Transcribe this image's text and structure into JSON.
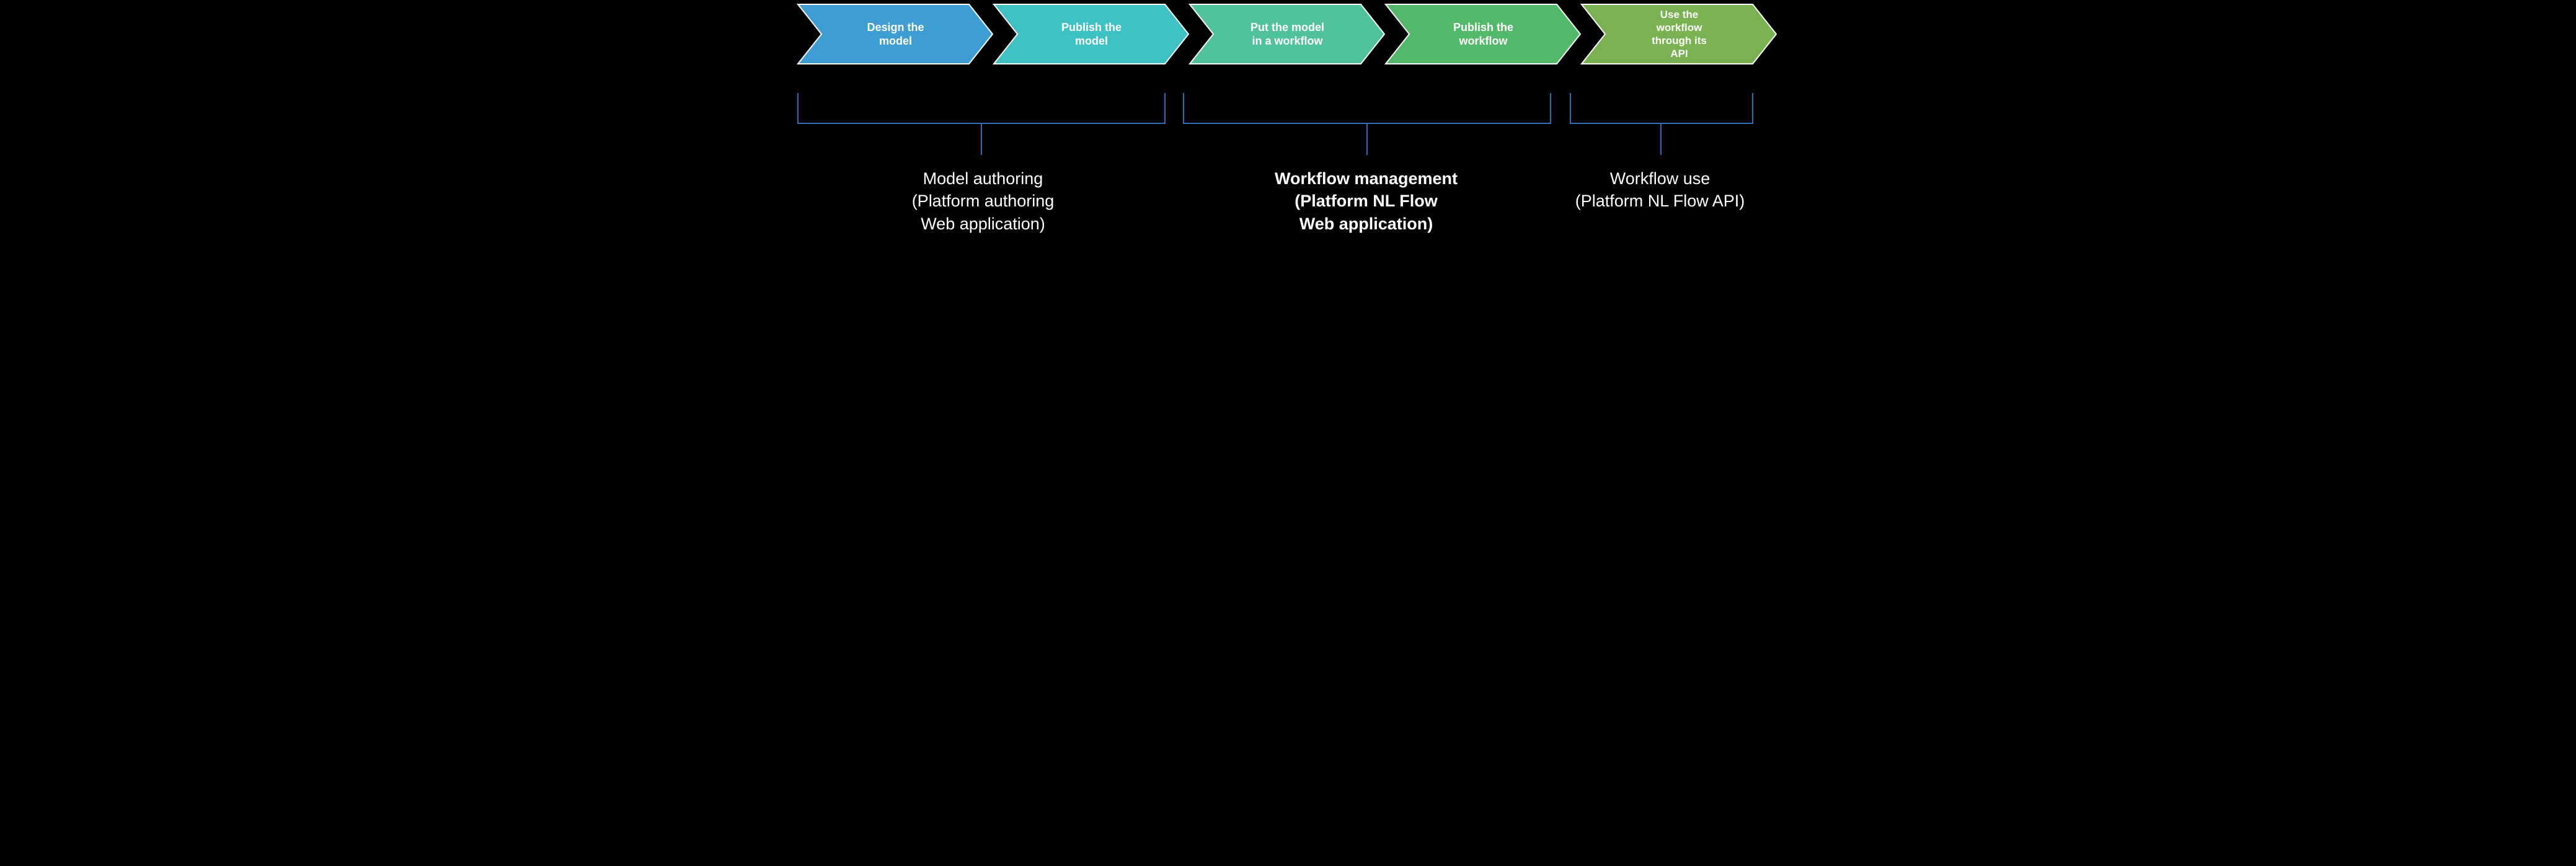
{
  "steps": [
    {
      "label": "Design the\nmodel",
      "fill": "#3e9ed4"
    },
    {
      "label": "Publish the\nmodel",
      "fill": "#3dc1c3"
    },
    {
      "label": "Put the model\nin a workflow",
      "fill": "#4fc29c"
    },
    {
      "label": "Publish the\nworkflow",
      "fill": "#53b96a"
    },
    {
      "label": "Use the\nworkflow\nthrough its\nAPI",
      "fill": "#7bb251"
    }
  ],
  "groups": [
    {
      "label": "Model authoring\n(Platform authoring\nWeb application)",
      "bold": false
    },
    {
      "label": "Workflow management\n(Platform NL Flow\nWeb application)",
      "bold": true
    },
    {
      "label": "Workflow use\n(Platform NL Flow API)",
      "bold": false
    }
  ],
  "chart_data": {
    "type": "process-chevron",
    "steps": [
      "Design the model",
      "Publish the model",
      "Put the model in a workflow",
      "Publish the workflow",
      "Use the workflow through its API"
    ],
    "groups": [
      {
        "name": "Model authoring (Platform authoring Web application)",
        "covers_steps": [
          1,
          2
        ],
        "emphasis": false
      },
      {
        "name": "Workflow management (Platform NL Flow Web application)",
        "covers_steps": [
          3,
          4
        ],
        "emphasis": true
      },
      {
        "name": "Workflow use (Platform NL Flow API)",
        "covers_steps": [
          5
        ],
        "emphasis": false
      }
    ],
    "palette": [
      "#3e9ed4",
      "#3dc1c3",
      "#4fc29c",
      "#53b96a",
      "#7bb251"
    ]
  }
}
